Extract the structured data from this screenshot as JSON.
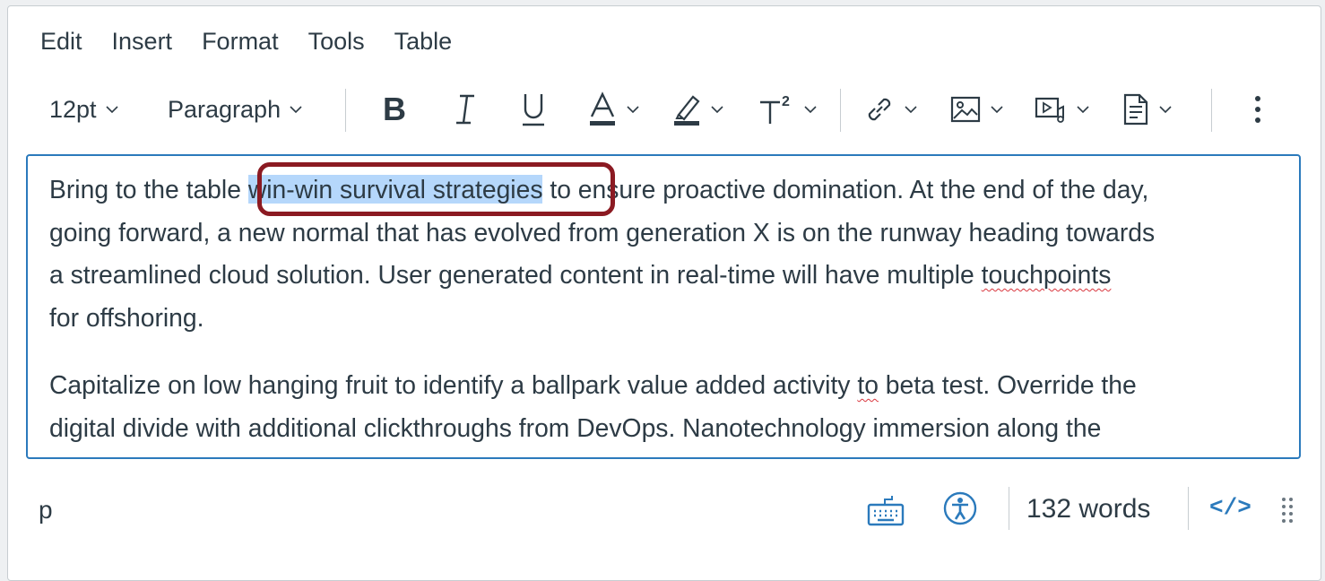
{
  "menubar": {
    "items": [
      {
        "label": "Edit"
      },
      {
        "label": "Insert"
      },
      {
        "label": "Format"
      },
      {
        "label": "Tools"
      },
      {
        "label": "Table"
      }
    ]
  },
  "toolbar": {
    "font_size": "12pt",
    "block_format": "Paragraph",
    "bold_icon": "bold-icon",
    "italic_icon": "italic-icon",
    "underline_icon": "underline-icon",
    "text_color_icon": "text-color-icon",
    "highlight_icon": "highlight-color-icon",
    "superscript_icon": "superscript-icon",
    "link_icon": "link-icon",
    "image_icon": "image-icon",
    "media_icon": "media-icon",
    "document_icon": "document-icon",
    "more_icon": "more-vertical-icon"
  },
  "content": {
    "paragraph1": {
      "line1_before": "Bring to the table ",
      "line1_highlight": "win-win survival strategies",
      "line1_after": " to ensure proactive domination. At the end of the day,",
      "line2": "going forward, a new normal that has evolved from generation X is on the runway heading towards",
      "line3_before": "a streamlined cloud solution. User generated content in real-time will have multiple ",
      "line3_misspelled": "touchpoints",
      "line4": "for offshoring."
    },
    "paragraph2": {
      "line1_before": "Capitalize on low hanging fruit to identify a ballpark value added activity ",
      "line1_misspelled": "to",
      "line1_after": " beta test. Override the",
      "line2": "digital divide with additional clickthroughs from DevOps. Nanotechnology immersion along the"
    }
  },
  "statusbar": {
    "path": "p",
    "word_count": "132 words",
    "html_toggle": "</>",
    "keyboard_icon": "keyboard-shortcuts-icon",
    "accessibility_icon": "accessibility-checker-icon",
    "resize_icon": "resize-handle-icon"
  },
  "colors": {
    "accent": "#2b7abc",
    "selection": "#b5d7fb",
    "callout": "#8b1a22",
    "text": "#2d3b45",
    "border": "#c7cdd1"
  }
}
